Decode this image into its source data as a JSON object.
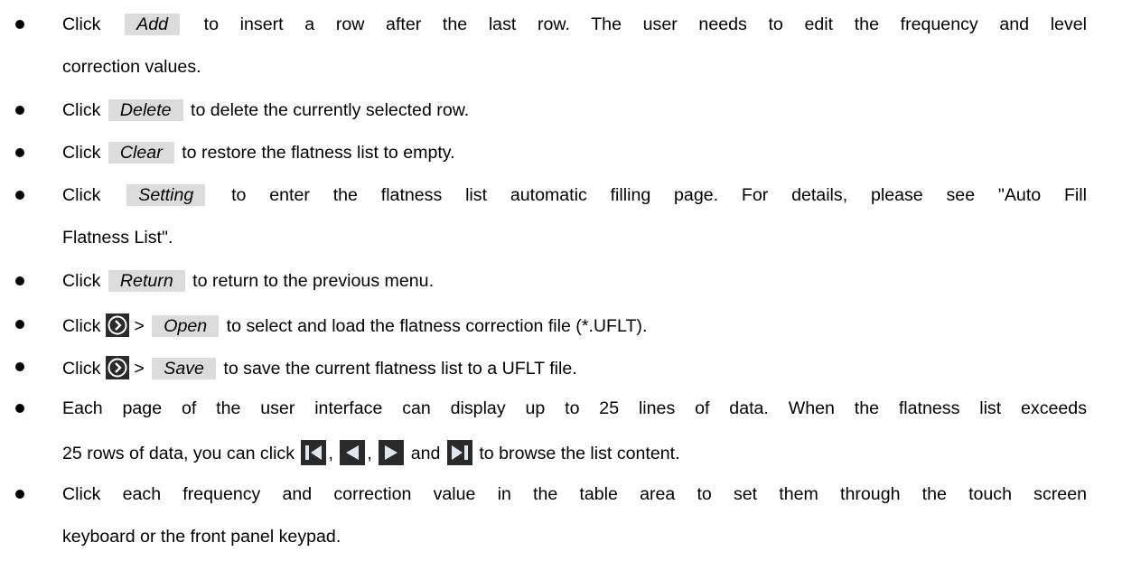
{
  "bullets": [
    {
      "pre": "Click",
      "button": "Add",
      "post": "to insert a row after the last row. The user needs to edit the frequency and level",
      "cont": "correction values."
    },
    {
      "pre": "Click",
      "button": "Delete",
      "post": "to delete the currently selected row."
    },
    {
      "pre": "Click",
      "button": "Clear",
      "post": "to restore the flatness list to empty."
    },
    {
      "pre": "Click",
      "button": "Setting",
      "post": "to enter the flatness list automatic filling page. For details, please see \"Auto Fill",
      "cont": "Flatness List\"."
    },
    {
      "pre": "Click",
      "button": "Return",
      "post": "to return to the previous menu."
    },
    {
      "pre": "Click",
      "sep": ">",
      "button": "Open",
      "post": "to select and load the flatness correction file (*.UFLT)."
    },
    {
      "pre": "Click",
      "sep": ">",
      "button": "Save",
      "post": "to save the current flatness list to a UFLT file."
    },
    {
      "line1": "Each page of the user interface can display up to 25 lines of data. When the flatness list exceeds",
      "line2_pre": "25 rows of data, you can click",
      "comma1": ",",
      "comma2": ",",
      "and": "and",
      "line2_post": "to browse the list content."
    },
    {
      "line1": "Click each frequency and correction value in the table area to set them through the touch screen",
      "line2": "keyboard or the front panel keypad."
    }
  ],
  "icons": {
    "more": "chevron-right-circle-icon",
    "first": "skip-to-first-icon",
    "prev": "previous-page-icon",
    "next": "next-page-icon",
    "last": "skip-to-last-icon"
  }
}
